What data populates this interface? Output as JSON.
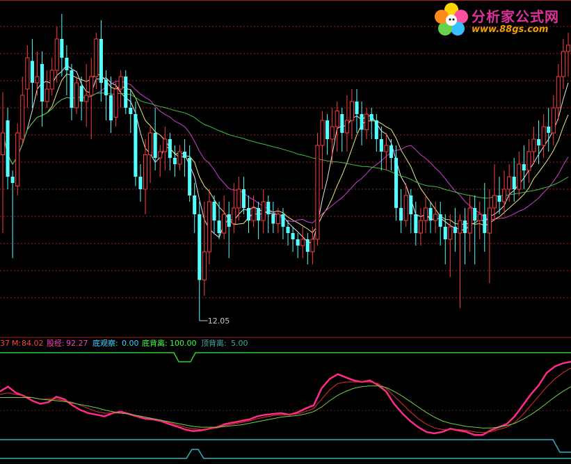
{
  "logo": {
    "title": "分析家公式网",
    "url": "www.88gs.com"
  },
  "indicator_labels": [
    {
      "key": "first",
      "text": "37",
      "color": "#ff4040"
    },
    {
      "key": "m_label",
      "text": "M:",
      "color": "#ff4040"
    },
    {
      "key": "m_value",
      "text": "84.02",
      "color": "#ff4040"
    },
    {
      "key": "gujing",
      "text": "股经:",
      "color": "#ff40c0"
    },
    {
      "key": "gujing_value",
      "text": "92.27",
      "color": "#ff40c0"
    },
    {
      "key": "diguancha",
      "text": "底观察:",
      "color": "#40d0ff"
    },
    {
      "key": "diguancha_value",
      "text": "0.00",
      "color": "#40d0ff"
    },
    {
      "key": "dibeili",
      "text": "底背离:",
      "color": "#40ff40"
    },
    {
      "key": "dibeili_value",
      "text": "100.00",
      "color": "#40ff40"
    },
    {
      "key": "dingbeili",
      "text": "顶背离:",
      "color": "#40a8a8"
    },
    {
      "key": "dingbeili_value",
      "text": "5.00",
      "color": "#40a8a8"
    }
  ],
  "chart_data": [
    {
      "type": "candlestick",
      "annotation_low": "12.05",
      "candles": [
        [
          0.55,
          0.62,
          0.3,
          0.75
        ],
        [
          0.66,
          0.48,
          0.44,
          0.7
        ],
        [
          0.48,
          0.46,
          0.22,
          0.5
        ],
        [
          0.45,
          0.62,
          0.42,
          0.65
        ],
        [
          0.6,
          0.74,
          0.58,
          0.8
        ],
        [
          0.76,
          0.86,
          0.7,
          0.9
        ],
        [
          0.85,
          0.78,
          0.7,
          0.92
        ],
        [
          0.78,
          0.8,
          0.74,
          0.88
        ],
        [
          0.84,
          0.72,
          0.64,
          0.88
        ],
        [
          0.72,
          0.76,
          0.7,
          0.82
        ],
        [
          0.76,
          0.82,
          0.74,
          0.86
        ],
        [
          0.82,
          0.92,
          0.78,
          0.96
        ],
        [
          0.92,
          0.86,
          0.8,
          1.0
        ],
        [
          0.86,
          0.82,
          0.74,
          0.9
        ],
        [
          0.82,
          0.7,
          0.66,
          0.84
        ],
        [
          0.7,
          0.78,
          0.68,
          0.8
        ],
        [
          0.77,
          0.72,
          0.66,
          0.8
        ],
        [
          0.72,
          0.74,
          0.64,
          0.84
        ],
        [
          0.74,
          0.8,
          0.6,
          0.86
        ],
        [
          0.8,
          0.92,
          0.76,
          0.94
        ],
        [
          0.92,
          0.78,
          0.72,
          0.98
        ],
        [
          0.79,
          0.74,
          0.66,
          0.82
        ],
        [
          0.74,
          0.66,
          0.62,
          0.8
        ],
        [
          0.67,
          0.76,
          0.64,
          0.78
        ],
        [
          0.76,
          0.8,
          0.7,
          0.82
        ],
        [
          0.8,
          0.7,
          0.68,
          0.82
        ],
        [
          0.7,
          0.68,
          0.62,
          0.76
        ],
        [
          0.68,
          0.48,
          0.45,
          0.72
        ],
        [
          0.48,
          0.44,
          0.4,
          0.52
        ],
        [
          0.44,
          0.55,
          0.36,
          0.6
        ],
        [
          0.55,
          0.62,
          0.46,
          0.64
        ],
        [
          0.62,
          0.54,
          0.5,
          0.7
        ],
        [
          0.54,
          0.56,
          0.48,
          0.58
        ],
        [
          0.56,
          0.6,
          0.5,
          0.64
        ],
        [
          0.6,
          0.54,
          0.5,
          0.62
        ],
        [
          0.54,
          0.52,
          0.48,
          0.58
        ],
        [
          0.52,
          0.56,
          0.5,
          0.58
        ],
        [
          0.56,
          0.54,
          0.48,
          0.6
        ],
        [
          0.54,
          0.42,
          0.4,
          0.58
        ],
        [
          0.42,
          0.36,
          0.3,
          0.46
        ],
        [
          0.36,
          0.15,
          0.02,
          0.4
        ],
        [
          0.15,
          0.24,
          0.1,
          0.4
        ],
        [
          0.24,
          0.4,
          0.2,
          0.44
        ],
        [
          0.4,
          0.34,
          0.3,
          0.42
        ],
        [
          0.34,
          0.3,
          0.28,
          0.4
        ],
        [
          0.3,
          0.36,
          0.28,
          0.42
        ],
        [
          0.36,
          0.32,
          0.22,
          0.4
        ],
        [
          0.33,
          0.38,
          0.3,
          0.46
        ],
        [
          0.38,
          0.44,
          0.34,
          0.48
        ],
        [
          0.44,
          0.38,
          0.36,
          0.48
        ],
        [
          0.38,
          0.34,
          0.3,
          0.42
        ],
        [
          0.34,
          0.38,
          0.32,
          0.42
        ],
        [
          0.38,
          0.34,
          0.28,
          0.4
        ],
        [
          0.34,
          0.4,
          0.3,
          0.44
        ],
        [
          0.4,
          0.36,
          0.3,
          0.42
        ],
        [
          0.36,
          0.33,
          0.3,
          0.4
        ],
        [
          0.33,
          0.36,
          0.3,
          0.38
        ],
        [
          0.36,
          0.32,
          0.28,
          0.38
        ],
        [
          0.32,
          0.3,
          0.26,
          0.34
        ],
        [
          0.3,
          0.28,
          0.24,
          0.32
        ],
        [
          0.28,
          0.26,
          0.22,
          0.3
        ],
        [
          0.26,
          0.28,
          0.22,
          0.32
        ],
        [
          0.28,
          0.24,
          0.2,
          0.3
        ],
        [
          0.24,
          0.28,
          0.2,
          0.32
        ],
        [
          0.28,
          0.58,
          0.26,
          0.62
        ],
        [
          0.58,
          0.66,
          0.44,
          0.69
        ],
        [
          0.66,
          0.6,
          0.55,
          0.68
        ],
        [
          0.6,
          0.64,
          0.52,
          0.7
        ],
        [
          0.64,
          0.69,
          0.56,
          0.72
        ],
        [
          0.68,
          0.62,
          0.56,
          0.7
        ],
        [
          0.62,
          0.66,
          0.56,
          0.74
        ],
        [
          0.66,
          0.72,
          0.6,
          0.76
        ],
        [
          0.72,
          0.68,
          0.62,
          0.76
        ],
        [
          0.68,
          0.63,
          0.58,
          0.72
        ],
        [
          0.63,
          0.68,
          0.6,
          0.7
        ],
        [
          0.68,
          0.66,
          0.6,
          0.7
        ],
        [
          0.66,
          0.6,
          0.56,
          0.68
        ],
        [
          0.6,
          0.56,
          0.5,
          0.64
        ],
        [
          0.56,
          0.58,
          0.5,
          0.62
        ],
        [
          0.58,
          0.54,
          0.5,
          0.6
        ],
        [
          0.54,
          0.38,
          0.34,
          0.58
        ],
        [
          0.38,
          0.34,
          0.3,
          0.44
        ],
        [
          0.34,
          0.42,
          0.32,
          0.46
        ],
        [
          0.42,
          0.36,
          0.3,
          0.44
        ],
        [
          0.36,
          0.3,
          0.26,
          0.4
        ],
        [
          0.3,
          0.34,
          0.26,
          0.38
        ],
        [
          0.34,
          0.38,
          0.3,
          0.42
        ],
        [
          0.38,
          0.34,
          0.3,
          0.4
        ],
        [
          0.34,
          0.36,
          0.3,
          0.4
        ],
        [
          0.36,
          0.32,
          0.26,
          0.4
        ],
        [
          0.32,
          0.28,
          0.2,
          0.36
        ],
        [
          0.28,
          0.32,
          0.16,
          0.36
        ],
        [
          0.32,
          0.3,
          0.24,
          0.38
        ],
        [
          0.3,
          0.34,
          0.06,
          0.36
        ],
        [
          0.34,
          0.3,
          0.2,
          0.38
        ],
        [
          0.3,
          0.38,
          0.24,
          0.42
        ],
        [
          0.38,
          0.34,
          0.2,
          0.42
        ],
        [
          0.34,
          0.36,
          0.28,
          0.4
        ],
        [
          0.36,
          0.3,
          0.24,
          0.46
        ],
        [
          0.3,
          0.38,
          0.14,
          0.44
        ],
        [
          0.38,
          0.42,
          0.34,
          0.52
        ],
        [
          0.42,
          0.4,
          0.36,
          0.48
        ],
        [
          0.4,
          0.44,
          0.36,
          0.5
        ],
        [
          0.44,
          0.48,
          0.4,
          0.52
        ],
        [
          0.48,
          0.44,
          0.4,
          0.54
        ],
        [
          0.44,
          0.52,
          0.42,
          0.56
        ],
        [
          0.52,
          0.5,
          0.44,
          0.58
        ],
        [
          0.5,
          0.56,
          0.46,
          0.6
        ],
        [
          0.56,
          0.6,
          0.52,
          0.64
        ],
        [
          0.6,
          0.58,
          0.52,
          0.66
        ],
        [
          0.58,
          0.64,
          0.54,
          0.68
        ],
        [
          0.64,
          0.62,
          0.56,
          0.7
        ],
        [
          0.62,
          0.7,
          0.58,
          0.74
        ],
        [
          0.7,
          0.8,
          0.66,
          0.84
        ],
        [
          0.8,
          0.88,
          0.76,
          0.92
        ],
        [
          0.88,
          0.9,
          0.8,
          0.94
        ]
      ]
    },
    {
      "type": "line",
      "series": [
        {
          "values": [
            0.62,
            0.68,
            0.6,
            0.56,
            0.5,
            0.46,
            0.48,
            0.55,
            0.52,
            0.44,
            0.38,
            0.34,
            0.32,
            0.3,
            0.34,
            0.36,
            0.33,
            0.3,
            0.27,
            0.26,
            0.24,
            0.2,
            0.17,
            0.13,
            0.11,
            0.12,
            0.14,
            0.16,
            0.2,
            0.22,
            0.24,
            0.26,
            0.3,
            0.32,
            0.33,
            0.34,
            0.32,
            0.35,
            0.4,
            0.44,
            0.66,
            0.78,
            0.84,
            0.8,
            0.76,
            0.74,
            0.76,
            0.7,
            0.62,
            0.46,
            0.34,
            0.24,
            0.16,
            0.1,
            0.08,
            0.1,
            0.14,
            0.12,
            0.1,
            0.06,
            0.06,
            0.12,
            0.16,
            0.2,
            0.3,
            0.44,
            0.58,
            0.7,
            0.86,
            0.94,
            0.98,
            1.0
          ]
        },
        {
          "values": [
            0.58,
            0.6,
            0.58,
            0.56,
            0.54,
            0.52,
            0.52,
            0.52,
            0.5,
            0.48,
            0.44,
            0.4,
            0.36,
            0.34,
            0.34,
            0.34,
            0.33,
            0.31,
            0.29,
            0.27,
            0.25,
            0.22,
            0.19,
            0.16,
            0.14,
            0.13,
            0.14,
            0.15,
            0.18,
            0.2,
            0.22,
            0.24,
            0.27,
            0.29,
            0.31,
            0.32,
            0.32,
            0.33,
            0.36,
            0.4,
            0.52,
            0.64,
            0.72,
            0.74,
            0.74,
            0.74,
            0.74,
            0.72,
            0.66,
            0.56,
            0.46,
            0.36,
            0.27,
            0.2,
            0.15,
            0.13,
            0.13,
            0.13,
            0.12,
            0.1,
            0.09,
            0.1,
            0.13,
            0.16,
            0.22,
            0.32,
            0.44,
            0.56,
            0.68,
            0.78,
            0.86,
            0.92
          ]
        },
        {
          "values": [
            0.54,
            0.54,
            0.54,
            0.54,
            0.54,
            0.52,
            0.51,
            0.5,
            0.49,
            0.47,
            0.45,
            0.43,
            0.41,
            0.38,
            0.36,
            0.34,
            0.33,
            0.31,
            0.29,
            0.27,
            0.25,
            0.23,
            0.21,
            0.19,
            0.17,
            0.16,
            0.16,
            0.16,
            0.17,
            0.18,
            0.19,
            0.21,
            0.23,
            0.25,
            0.27,
            0.29,
            0.3,
            0.31,
            0.33,
            0.36,
            0.42,
            0.5,
            0.57,
            0.62,
            0.66,
            0.68,
            0.69,
            0.69,
            0.67,
            0.62,
            0.56,
            0.49,
            0.42,
            0.35,
            0.29,
            0.24,
            0.21,
            0.19,
            0.17,
            0.16,
            0.15,
            0.15,
            0.16,
            0.18,
            0.21,
            0.26,
            0.32,
            0.39,
            0.47,
            0.55,
            0.62,
            0.68
          ]
        }
      ]
    }
  ]
}
